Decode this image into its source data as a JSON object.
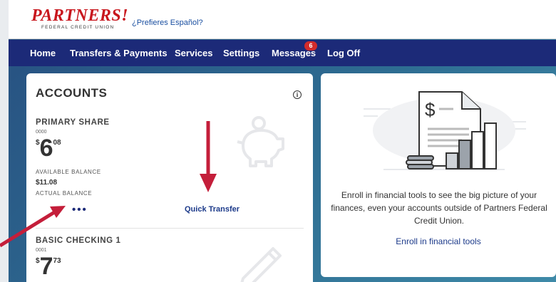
{
  "header": {
    "logo_text": "PARTNERS!",
    "logo_subtext": "FEDERAL CREDIT UNION",
    "language_link": "¿Prefieres Español?"
  },
  "nav": {
    "items": [
      "Home",
      "Transfers & Payments",
      "Services",
      "Settings",
      "Messages",
      "Log Off"
    ],
    "messages_badge": "6"
  },
  "accounts": {
    "title": "ACCOUNTS",
    "info_icon": "info-icon",
    "primary": {
      "name": "PRIMARY SHARE",
      "number": "0000",
      "currency": "$",
      "dollars": "6",
      "cents": "08",
      "available_label": "AVAILABLE BALANCE",
      "actual_value": "$11.08",
      "actual_label": "ACTUAL BALANCE",
      "more": "•••",
      "quick_transfer": "Quick Transfer"
    },
    "checking": {
      "name": "BASIC CHECKING 1",
      "number": "0001",
      "currency": "$",
      "dollars": "7",
      "cents": "73"
    }
  },
  "financial_tools": {
    "description": "Enroll in financial tools to see the big picture of your finances, even your accounts outside of Partners Federal Credit Union.",
    "link": "Enroll in financial tools"
  },
  "colors": {
    "brand_red": "#c8161d",
    "nav_bg": "#1c2a78",
    "badge": "#d22b2b",
    "annotation_arrow": "#c41e3a"
  }
}
